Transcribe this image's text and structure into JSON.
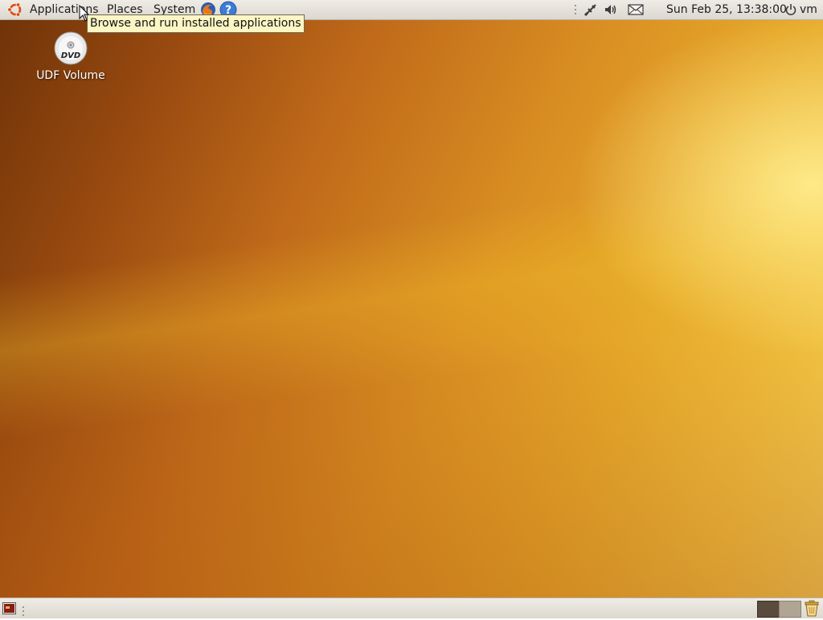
{
  "top_panel": {
    "menus": {
      "applications": "Applications",
      "places": "Places",
      "system": "System"
    },
    "clock": "Sun Feb 25, 13:38:00",
    "user": "vm",
    "icons": [
      "ubuntu-logo-icon",
      "firefox-icon",
      "help-icon",
      "network-icon",
      "volume-icon",
      "mail-icon",
      "power-icon"
    ]
  },
  "tooltip": {
    "text": "Browse and run installed applications"
  },
  "desktop": {
    "icons": [
      {
        "label": "UDF Volume",
        "icon": "dvd-icon"
      }
    ]
  },
  "bottom_panel": {
    "icons": [
      "show-desktop-icon",
      "workspace-switcher",
      "trash-icon"
    ]
  },
  "colors": {
    "panel_bg": "#dcd8d0",
    "tooltip_bg": "#fbf6c4",
    "wallpaper_dark": "#6e3208",
    "wallpaper_light": "#f4d05a"
  }
}
